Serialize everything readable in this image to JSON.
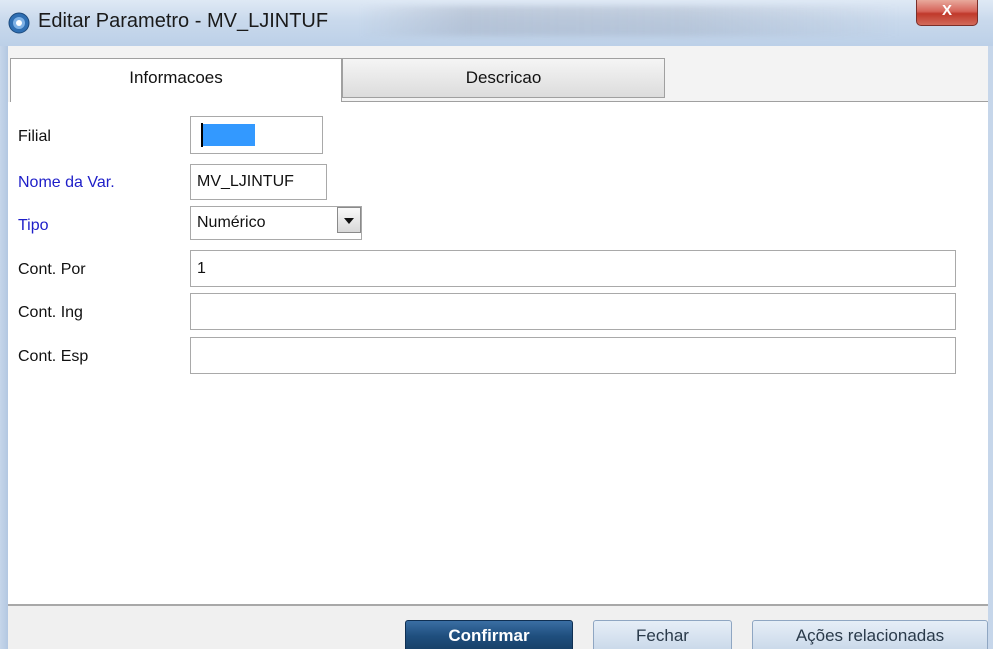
{
  "window": {
    "title": "Editar Parametro - MV_LJINTUF",
    "close_label": "X"
  },
  "tabs": [
    {
      "label": "Informacoes",
      "active": true
    },
    {
      "label": "Descricao",
      "active": false
    }
  ],
  "form": {
    "filial": {
      "label": "Filial",
      "value": ""
    },
    "nome_var": {
      "label": "Nome da Var.",
      "value": "MV_LJINTUF"
    },
    "tipo": {
      "label": "Tipo",
      "value": "Numérico"
    },
    "cont_por": {
      "label": "Cont. Por",
      "value": "1"
    },
    "cont_ing": {
      "label": "Cont. Ing",
      "value": ""
    },
    "cont_esp": {
      "label": "Cont. Esp",
      "value": ""
    }
  },
  "footer": {
    "confirm_label": "Confirmar",
    "close_label": "Fechar",
    "actions_label": "Ações relacionadas"
  },
  "colors": {
    "required_label": "#1e1ec8",
    "selection": "#3399ff",
    "confirm_button": "#1f4f7e"
  }
}
